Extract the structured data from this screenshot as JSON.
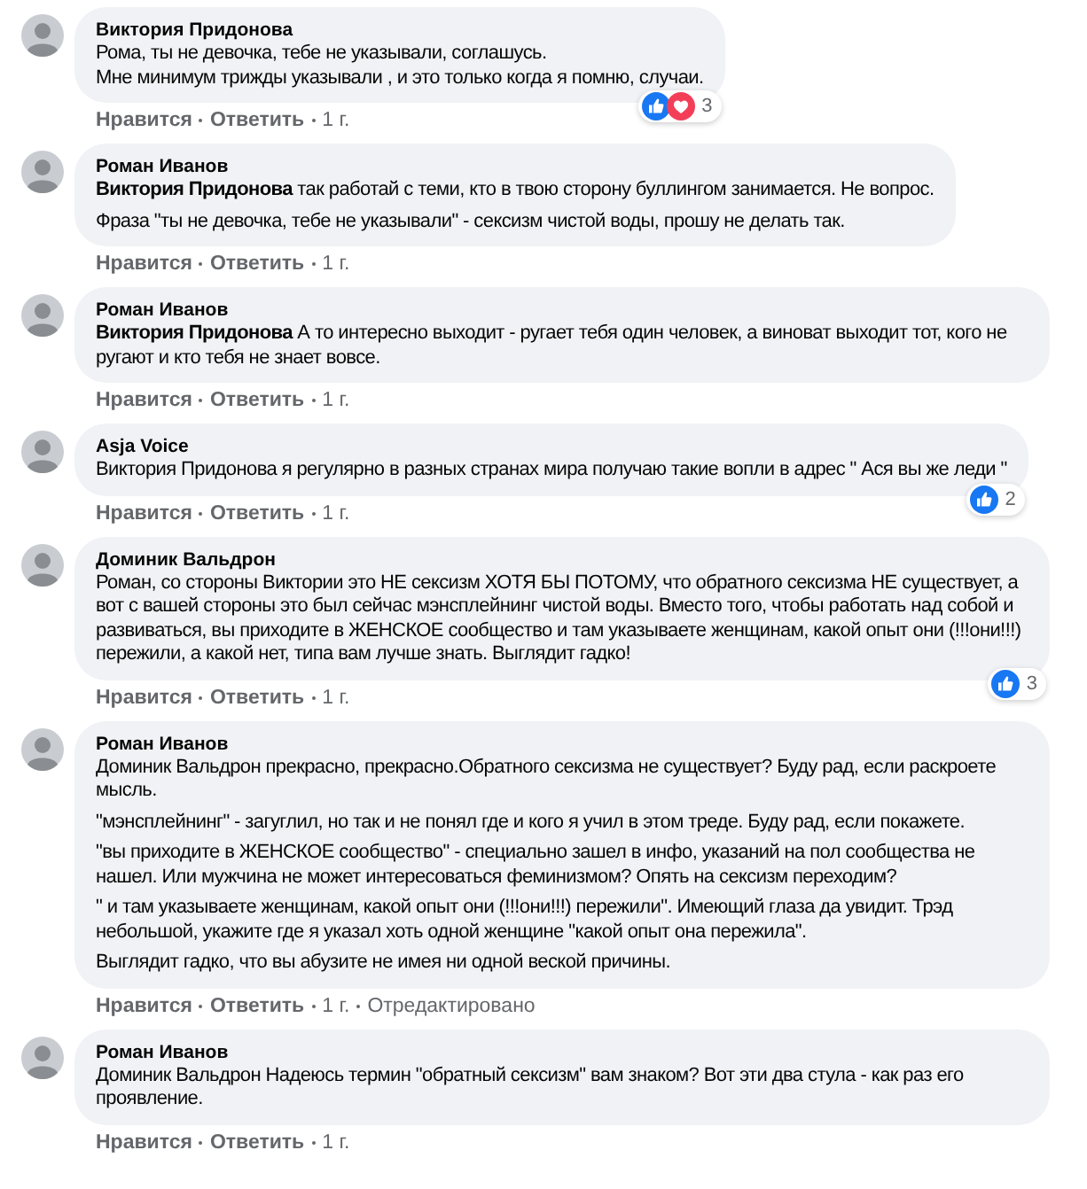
{
  "comments": [
    {
      "author": "Виктория Придонова",
      "paragraphs": [
        "Рома, ты не девочка, тебе не указывали, соглашусь.\nМне минимум трижды указывали , и это только когда я помню, случаи."
      ],
      "reactions": {
        "types": [
          {
            "kind": "like"
          },
          {
            "kind": "love"
          }
        ],
        "count": "3"
      },
      "actions": {
        "like": "Нравится",
        "reply": "Ответить",
        "time": "1 г."
      }
    },
    {
      "author": "Роман Иванов",
      "paragraphs": [
        "**Виктория Придонова** так работай с теми, кто в твою сторону буллингом занимается. Не вопрос.",
        "Фраза \"ты не девочка, тебе не указывали\" - сексизм чистой воды, прошу не делать так."
      ],
      "actions": {
        "like": "Нравится",
        "reply": "Ответить",
        "time": "1 г."
      }
    },
    {
      "author": "Роман Иванов",
      "paragraphs": [
        "**Виктория Придонова** А то интересно выходит - ругает тебя один человек, а виноват выходит тот, кого не ругают и кто тебя не знает вовсе."
      ],
      "actions": {
        "like": "Нравится",
        "reply": "Ответить",
        "time": "1 г."
      }
    },
    {
      "author": "Asja Voice",
      "paragraphs": [
        "Виктория Придонова я регулярно в разных странах мира получаю такие вопли в адрес \" Ася вы же леди \""
      ],
      "reactions": {
        "types": [
          {
            "kind": "like"
          }
        ],
        "count": "2"
      },
      "actions": {
        "like": "Нравится",
        "reply": "Ответить",
        "time": "1 г."
      }
    },
    {
      "author": "Доминик Вальдрон",
      "paragraphs": [
        "Роман, со стороны Виктории это НЕ сексизм ХОТЯ БЫ ПОТОМУ, что обратного сексизма НЕ существует, а вот с вашей стороны это был сейчас мэнсплейнинг чистой воды. Вместо того, чтобы работать над собой и развиваться, вы приходите в ЖЕНСКОЕ сообщество и там указываете женщинам, какой опыт они (!!!они!!!) пережили, а какой нет, типа вам лучше знать. Выглядит гадко!"
      ],
      "reactions": {
        "types": [
          {
            "kind": "like"
          }
        ],
        "count": "3"
      },
      "actions": {
        "like": "Нравится",
        "reply": "Ответить",
        "time": "1 г."
      }
    },
    {
      "author": "Роман Иванов",
      "paragraphs": [
        "Доминик Вальдрон прекрасно, прекрасно.Обратного сексизма не существует? Буду рад, если раскроете мысль.",
        "\"мэнсплейнинг\" - загуглил, но так и не понял где и кого я учил в этом треде. Буду рад, если покажете.",
        "\"вы приходите в ЖЕНСКОЕ сообщество\" - специально зашел в инфо, указаний на пол сообщества не нашел. Или мужчина не может интересоваться феминизмом? Опять на сексизм переходим?",
        "\" и там указываете женщинам, какой опыт они (!!!они!!!) пережили\". Имеющий глаза да увидит. Трэд небольшой, укажите где я указал хоть одной женщине \"какой опыт она пережила\".",
        "Выглядит гадко, что вы абузите не имея ни одной веской причины."
      ],
      "actions": {
        "like": "Нравится",
        "reply": "Ответить",
        "time": "1 г.",
        "edited": "Отредактировано"
      }
    },
    {
      "author": "Роман Иванов",
      "paragraphs": [
        "Доминик Вальдрон Надеюсь термин \"обратный сексизм\" вам знаком? Вот эти два стула - как раз его проявление."
      ],
      "actions": {
        "like": "Нравится",
        "reply": "Ответить",
        "time": "1 г."
      }
    }
  ]
}
